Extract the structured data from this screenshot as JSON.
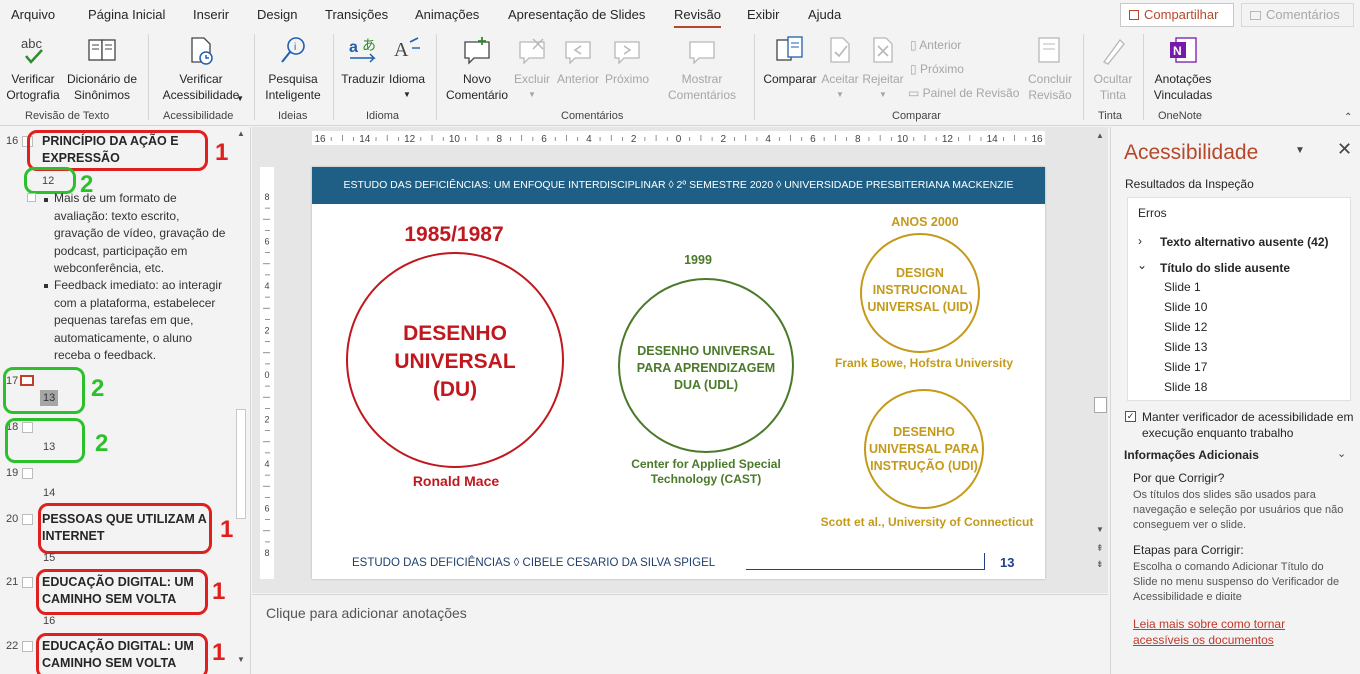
{
  "tabs": [
    "Arquivo",
    "Página Inicial",
    "Inserir",
    "Design",
    "Transições",
    "Animações",
    "Apresentação de Slides",
    "Revisão",
    "Exibir",
    "Ajuda"
  ],
  "active_tab": "Revisão",
  "share_label": "Compartilhar",
  "comments_label": "Comentários",
  "ribbon": {
    "spelling": "Verificar\nOrtografia",
    "spelling_icon_text": "abc",
    "thesaurus": "Dicionário de\nSinônimos",
    "check_accessibility": "Verificar\nAcessibilidade",
    "smart_lookup": "Pesquisa\nInteligente",
    "translate": "Traduzir",
    "language": "Idioma",
    "new_comment": "Novo\nComentário",
    "delete": "Excluir",
    "previous": "Anterior",
    "next": "Próximo",
    "show_comments": "Mostrar\nComentários",
    "compare": "Comparar",
    "accept": "Aceitar",
    "reject": "Rejeitar",
    "compare_previous": "Anterior",
    "compare_next": "Próximo",
    "reviewing_pane": "Painel de Revisão",
    "end_review": "Concluir\nRevisão",
    "hide_ink": "Ocultar\nTinta",
    "linked_notes": "Anotações\nVinculadas",
    "groups": [
      "Revisão de Texto",
      "Acessibilidade",
      "Ideias",
      "Idioma",
      "Comentários",
      "Comparar",
      "Tinta",
      "OneNote"
    ]
  },
  "outline": {
    "slide16_num": "16",
    "slide16_title": "PRINCÍPIO DA AÇÃO E EXPRESSÃO",
    "slide16_page": "12",
    "slide16_bullet1": "Mais de um formato de avaliação: texto escrito, gravação de vídeo, gravação de podcast, participação em webconferência, etc.",
    "slide16_bullet2": "Feedback imediato: ao interagir com a plataforma, estabelecer pequenas tarefas em que, automaticamente, o aluno receba o feedback.",
    "slide17_num": "17",
    "slide17_page": "13",
    "slide18_num": "18",
    "slide18_page": "13",
    "slide19_num": "19",
    "slide19_page": "14",
    "slide20_num": "20",
    "slide20_title": "PESSOAS QUE UTILIZAM A INTERNET",
    "slide20_page": "15",
    "slide21_num": "21",
    "slide21_title": "EDUCAÇÃO DIGITAL: UM CAMINHO SEM VOLTA",
    "slide21_page": "16",
    "slide22_num": "22",
    "slide22_title": "EDUCAÇÃO DIGITAL: UM CAMINHO SEM VOLTA",
    "annot_1": "1",
    "annot_2": "2"
  },
  "slide": {
    "header": "ESTUDO DAS DEFICIÊNCIAS: UM ENFOQUE INTERDISCIPLINAR ◊  2º SEMESTRE 2020  ◊  UNIVERSIDADE PRESBITERIANA MACKENZIE",
    "year1": "1985/1987",
    "circle1": "DESENHO UNIVERSAL (DU)",
    "author1": "Ronald Mace",
    "year2": "1999",
    "circle2": "DESENHO UNIVERSAL PARA APRENDIZAGEM DUA (UDL)",
    "author2": "Center for Applied Special Technology (CAST)",
    "year3": "ANOS 2000",
    "circle3": "DESIGN INSTRUCIONAL UNIVERSAL (UID)",
    "author3": "Frank Bowe, Hofstra University",
    "circle4": "DESENHO UNIVERSAL PARA INSTRUÇÃO (UDI)",
    "author4": "Scott et al., University of Connecticut",
    "footer": "ESTUDO DAS DEFICIÊNCIAS  ◊  CIBELE CESARIO DA SILVA SPIGEL",
    "page_number": "13",
    "colors": {
      "red": "#c0181e",
      "green": "#4a7a2a",
      "gold": "#c49a1a",
      "header": "#1f5f85",
      "page": "#1f3f8a"
    }
  },
  "ruler_labels": [
    "16",
    "14",
    "12",
    "10",
    "8",
    "6",
    "4",
    "2",
    "0",
    "2",
    "4",
    "6",
    "8",
    "10",
    "12",
    "14",
    "16"
  ],
  "vruler_labels": [
    "8",
    "6",
    "4",
    "2",
    "0",
    "2",
    "4",
    "6",
    "8"
  ],
  "notes_placeholder": "Clique para adicionar anotações",
  "accessibility": {
    "title": "Acessibilidade",
    "results_label": "Resultados da Inspeção",
    "errors_header": "Erros",
    "missing_alt": "Texto alternativo ausente (42)",
    "missing_title": "Título do slide ausente",
    "slides": [
      "Slide 1",
      "Slide 10",
      "Slide 12",
      "Slide 13",
      "Slide 17",
      "Slide 18"
    ],
    "keep_checker": "Manter verificador de acessibilidade em execução enquanto trabalho",
    "additional_info": "Informações Adicionais",
    "why_fix": "Por que Corrigir?",
    "why_fix_text": "Os títulos dos slides são usados para navegação e seleção por usuários que não conseguem ver o slide.",
    "steps_fix": "Etapas para Corrigir:",
    "steps_fix_text": "Escolha o comando Adicionar Título do Slide no menu suspenso do Verificador de Acessibilidade e digite",
    "learn_more": "Leia mais sobre como tornar acessíveis os documentos"
  }
}
